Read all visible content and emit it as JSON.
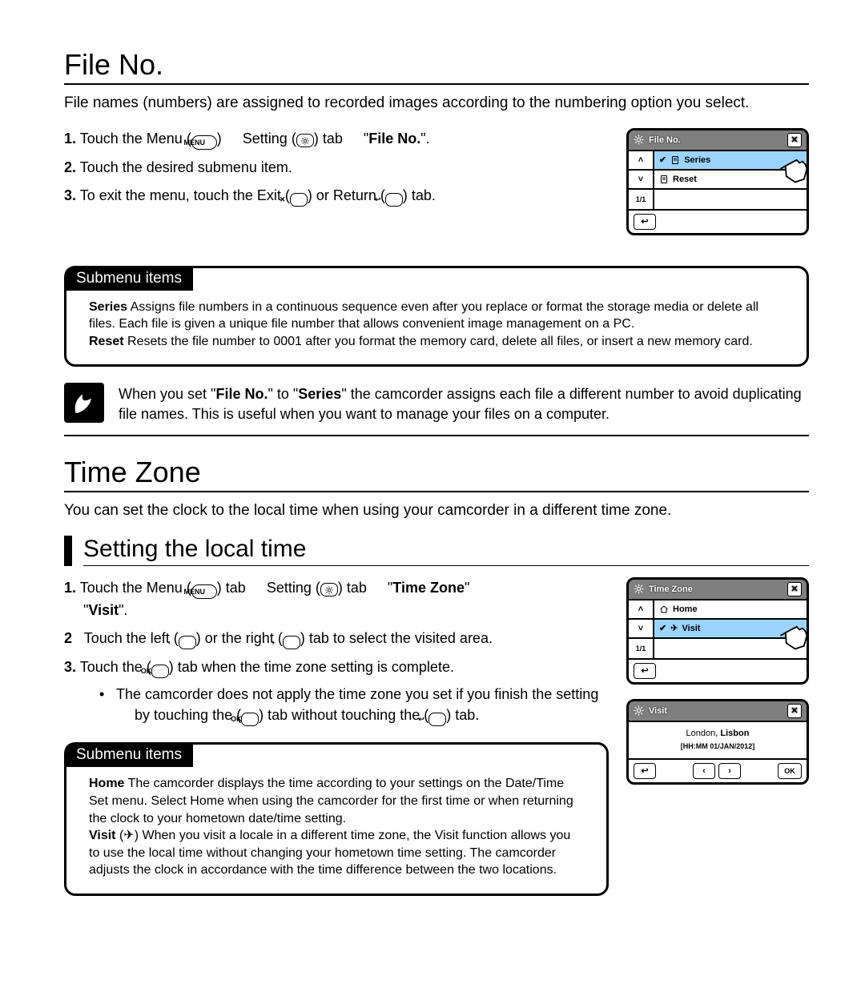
{
  "section1": {
    "title": "File No.",
    "intro": "File names (numbers) are assigned to recorded images according to the numbering option you select.",
    "steps": {
      "s1_num": "1.",
      "s1_a": "Touch the Menu (",
      "s1_menu": "MENU",
      "s1_b": ")",
      "s1_c": "Setting (",
      "s1_d": ") tab",
      "s1_e": "\"",
      "s1_bold": "File No.",
      "s1_f": "\".",
      "s2_num": "2.",
      "s2": "Touch the desired submenu item.",
      "s3_num": "3.",
      "s3_a": "To exit the menu, touch the Exit (",
      "s3_b": ") or Return (",
      "s3_c": ") tab."
    },
    "submenu_title": "Submenu items",
    "submenu": {
      "series_name": "Series",
      "series_desc": "  Assigns file numbers in a continuous sequence even after you replace or format the storage media or delete all files. Each file is given a unique file number that allows convenient image management on a PC.",
      "reset_name": "Reset",
      "reset_desc": "  Resets the file number to 0001 after you format the memory card, delete all files, or insert a new memory card."
    },
    "note_a": "When you set \"",
    "note_b1": "File No.",
    "note_c": "\" to \"",
    "note_b2": "Series",
    "note_d": "\"  the camcorder assigns each file a different number to avoid duplicating file names. This is useful when you want to manage your files on a computer.",
    "lcd": {
      "title": "File No.",
      "item1": "Series",
      "item2": "Reset",
      "frac": "1/1"
    }
  },
  "section2": {
    "title": "Time Zone",
    "intro": "You can set the clock to the local time when using your camcorder in a different time zone.",
    "subheading": "Setting the local time",
    "steps": {
      "s1_num": "1.",
      "s1_a": "Touch the Menu (",
      "s1_menu": "MENU",
      "s1_b": ") tab",
      "s1_c": "Setting (",
      "s1_d": ") tab",
      "s1_e": "\"",
      "s1_bold1": "Time Zone",
      "s1_f": "\"",
      "s1_g": "\"",
      "s1_bold2": "Visit",
      "s1_h": "\".",
      "s2_num": "2",
      "s2_a": "Touch the left (",
      "s2_b": ") or the right (",
      "s2_c": ") tab to select the visited area.",
      "s3_num": "3.",
      "s3_a": "Touch the (",
      "s3_ok": "OK",
      "s3_b": ") tab when the time zone setting is complete.",
      "bull_a": "The camcorder does not apply the time zone you set if you finish the setting by touching the (",
      "bull_b": ") tab without touching the (",
      "bull_c": ") tab."
    },
    "submenu_title": "Submenu items",
    "submenu": {
      "home_name": "Home",
      "home_desc": "  The camcorder displays the time according to your settings on the Date/Time Set menu. Select Home when using the camcorder for the first time or when returning the clock to your hometown date/time setting.",
      "visit_name": "Visit",
      "visit_paren": " (",
      "visit_paren2": ")   ",
      "visit_desc": "When you visit a locale in a different time zone, the Visit function allows you to use the local time without changing your hometown time setting. The camcorder adjusts the clock in accordance with the time difference between the two locations."
    },
    "lcd1": {
      "title": "Time Zone",
      "item1": "Home",
      "item2": "Visit",
      "frac": "1/1"
    },
    "lcd2": {
      "title": "Visit",
      "city1": "London,",
      "city2": "Lisbon",
      "date": "[HH:MM 01/JAN/2012]",
      "left": "‹",
      "right": "›",
      "ok": "OK"
    }
  }
}
